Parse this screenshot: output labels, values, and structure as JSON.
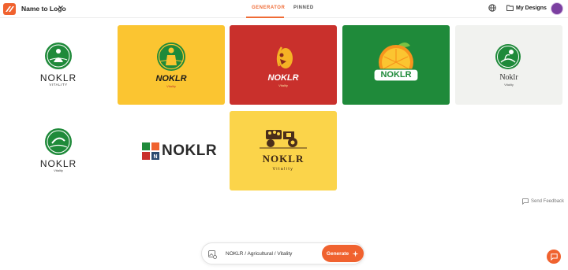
{
  "app": {
    "title": "Name to Logo"
  },
  "tabs": [
    {
      "label": "GENERATOR",
      "active": true
    },
    {
      "label": "PINNED",
      "active": false
    }
  ],
  "header": {
    "my_designs": "My Designs"
  },
  "colors": {
    "accent": "#ef6b35",
    "green": "#1f8a3a",
    "yellow": "#fbc531",
    "red": "#c9302c"
  },
  "logos": [
    {
      "brand": "NOKLR",
      "tagline": "VITALITY"
    },
    {
      "brand": "NOKLR",
      "tagline": "Vitality"
    },
    {
      "brand": "NOKLR",
      "tagline": "Vitality"
    },
    {
      "brand": "NOKLR"
    },
    {
      "brand": "Noklr",
      "tagline": "Vitality"
    },
    {
      "brand": "NOKLR",
      "tagline": "Vitality"
    },
    {
      "brand": "NOKLR"
    },
    {
      "brand": "NOKLR",
      "tagline": "Vitality"
    }
  ],
  "feedback": {
    "label": "Send Feedback"
  },
  "prompt": {
    "text": "NOKLR / Agricultural / Vitality",
    "button": "Generate"
  }
}
